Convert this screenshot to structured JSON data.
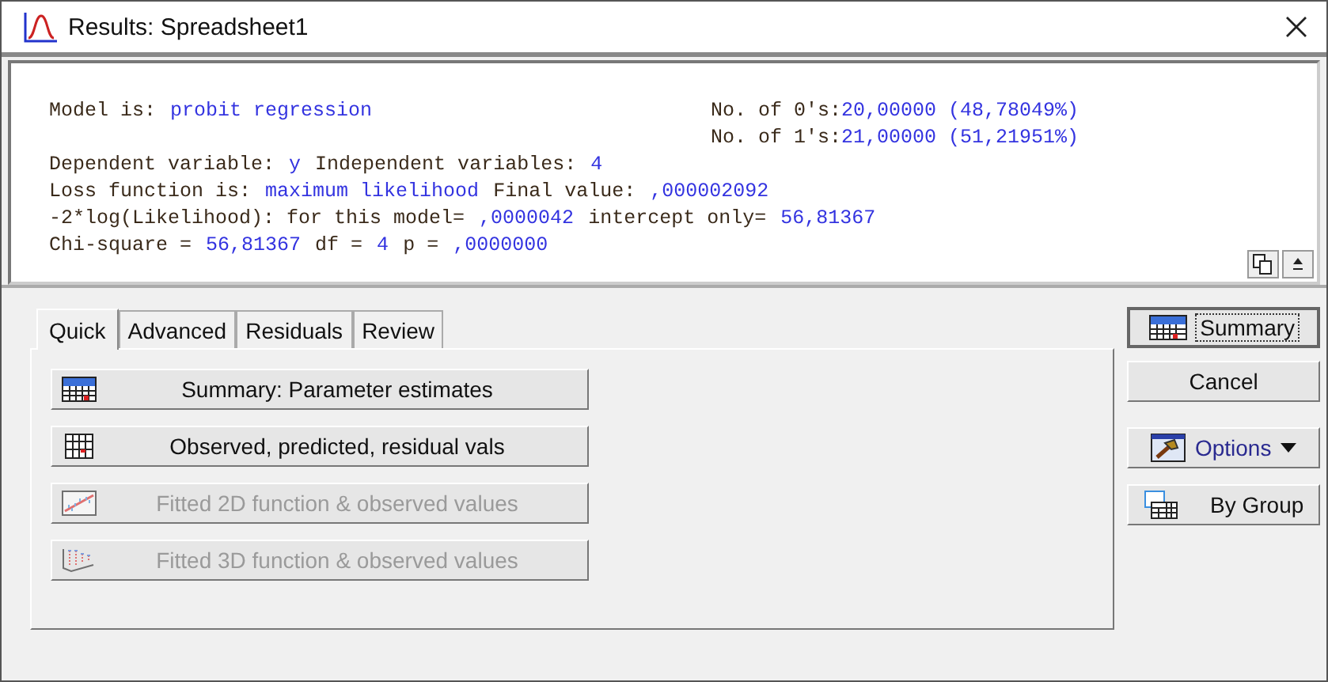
{
  "window": {
    "title": "Results: Spreadsheet1"
  },
  "output": {
    "lines": [
      {
        "left": [
          {
            "kind": "label",
            "text": "Model is:"
          },
          {
            "kind": "value",
            "text": "probit regression"
          }
        ],
        "right": [
          {
            "kind": "label",
            "text": "No. of 0's:"
          },
          {
            "kind": "value",
            "text": "20,00000 (48,78049%)"
          }
        ]
      },
      {
        "right": [
          {
            "kind": "label",
            "text": "No. of 1's:"
          },
          {
            "kind": "value",
            "text": "21,00000 (51,21951%)"
          }
        ]
      },
      {
        "left": [
          {
            "kind": "label",
            "text": "Dependent variable:"
          },
          {
            "kind": "value",
            "text": "y"
          },
          {
            "kind": "label",
            "text": "Independent variables:"
          },
          {
            "kind": "value",
            "text": "4"
          }
        ]
      },
      {
        "left": [
          {
            "kind": "label",
            "text": "Loss function is:"
          },
          {
            "kind": "value",
            "text": "maximum likelihood"
          },
          {
            "kind": "label",
            "text": "Final value:"
          },
          {
            "kind": "value",
            "text": ",000002092"
          }
        ]
      },
      {
        "left": [
          {
            "kind": "label",
            "text": "-2*log(Likelihood): for this model="
          },
          {
            "kind": "value",
            "text": ",0000042"
          },
          {
            "kind": "label",
            "text": "intercept only="
          },
          {
            "kind": "value",
            "text": "56,81367"
          }
        ]
      },
      {
        "left": [
          {
            "kind": "label",
            "text": "Chi-square ="
          },
          {
            "kind": "value",
            "text": "56,81367"
          },
          {
            "kind": "label",
            "text": "df ="
          },
          {
            "kind": "value",
            "text": "4"
          },
          {
            "kind": "label",
            "text": "p ="
          },
          {
            "kind": "value",
            "text": ",0000000"
          }
        ]
      }
    ]
  },
  "tabs": [
    {
      "label": "Quick",
      "selected": true
    },
    {
      "label": "Advanced",
      "selected": false
    },
    {
      "label": "Residuals",
      "selected": false
    },
    {
      "label": "Review",
      "selected": false
    }
  ],
  "actions": [
    {
      "kind": "summary",
      "label": "Summary: Parameter estimates",
      "disabled": false
    },
    {
      "kind": "table",
      "label": "Observed, predicted, residual vals",
      "disabled": false
    },
    {
      "kind": "plot2d",
      "label": "Fitted 2D function & observed values",
      "disabled": true
    },
    {
      "kind": "plot3d",
      "label": "Fitted 3D function & observed values",
      "disabled": true
    }
  ],
  "side_buttons": [
    {
      "kind": "summary",
      "label": "Summary"
    },
    {
      "kind": "plain",
      "label": "Cancel"
    },
    {
      "kind": "options",
      "label": "Options"
    },
    {
      "kind": "bygroup",
      "label": "By Group"
    }
  ]
}
